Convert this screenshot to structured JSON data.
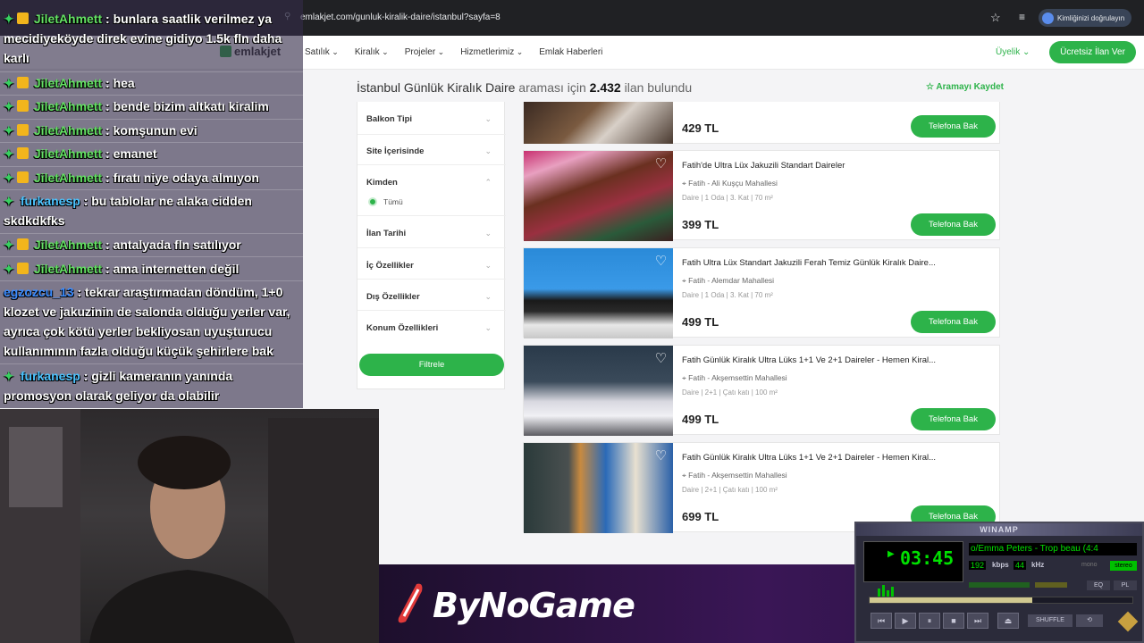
{
  "browser": {
    "url": "emlakjet.com/gunluk-kiralik-daire/istanbul?sayfa=8",
    "profile_label": "Kimliğinizi doğrulayın"
  },
  "site": {
    "logo_text": "emlakjet",
    "nav": [
      "Satılık",
      "Kiralık",
      "Projeler",
      "Hizmetlerimiz",
      "Emlak Haberleri"
    ],
    "uyelik": "Üyelik",
    "cta": "Ücretsiz İlan Ver"
  },
  "results": {
    "query": "İstanbul Günlük Kiralık Daire",
    "middle": " araması için ",
    "count": "2.432",
    "suffix": " ilan bulundu",
    "save": "Aramayı Kaydet"
  },
  "filters": {
    "items": [
      "Balkon Tipi",
      "Site İçerisinde",
      "Kimden",
      "İlan Tarihi",
      "İç Özellikler",
      "Dış Özellikler",
      "Konum Özellikleri"
    ],
    "kimden_option": "Tümü",
    "button": "Filtrele"
  },
  "listings": [
    {
      "title": "",
      "location": "",
      "details": "",
      "price": "429 TL",
      "call": "Telefona Bak"
    },
    {
      "title": "Fatih'de Ultra Lüx Jakuzili Standart Daireler",
      "location": "Fatih - Ali Kuşçu Mahallesi",
      "details": "Daire | 1 Oda | 3. Kat | 70 m²",
      "price": "399 TL",
      "call": "Telefona Bak"
    },
    {
      "title": "Fatih Ultra Lüx Standart Jakuzili Ferah Temiz Günlük Kiralık Daire...",
      "location": "Fatih - Alemdar Mahallesi",
      "details": "Daire | 1 Oda | 3. Kat | 70 m²",
      "price": "499 TL",
      "call": "Telefona Bak"
    },
    {
      "title": "Fatih Günlük Kiralık Ultra Lüks 1+1 Ve 2+1 Daireler - Hemen Kiral...",
      "location": "Fatih - Akşemsettin Mahallesi",
      "details": "Daire | 2+1 | Çatı katı | 100 m²",
      "price": "499 TL",
      "call": "Telefona Bak"
    },
    {
      "title": "Fatih Günlük Kiralık Ultra Lüks 1+1 Ve 2+1 Daireler - Hemen Kiral...",
      "location": "Fatih - Akşemsettin Mahallesi",
      "details": "Daire | 2+1 | Çatı katı | 100 m²",
      "price": "699 TL",
      "call": "Telefona Bak"
    }
  ],
  "chat": [
    {
      "user": "JiletAhmett",
      "text": ": bunlara saatlik verilmez ya mecidiyeköyde direk evine gidiyo 1.5k fln daha karlı",
      "color": "green",
      "badges": true
    },
    {
      "user": "JiletAhmett",
      "text": ": hea",
      "color": "green",
      "badges": true
    },
    {
      "user": "JiletAhmett",
      "text": ": bende bizim altkatı kiralim",
      "color": "green",
      "badges": true
    },
    {
      "user": "JiletAhmett",
      "text": ": komşunun evi",
      "color": "green",
      "badges": true
    },
    {
      "user": "JiletAhmett",
      "text": ": emanet",
      "color": "green",
      "badges": true
    },
    {
      "user": "JiletAhmett",
      "text": ": fıratı niye odaya almıyon",
      "color": "green",
      "badges": true
    },
    {
      "user": "furkanesp",
      "text": ": bu tablolar ne alaka cidden skdkdkfks",
      "color": "cyan",
      "badges": false
    },
    {
      "user": "JiletAhmett",
      "text": ": antalyada fln satılıyor",
      "color": "green",
      "badges": true
    },
    {
      "user": "JiletAhmett",
      "text": ": ama internetten değil",
      "color": "green",
      "badges": true
    },
    {
      "user": "egzozcu_13",
      "text": ": tekrar araştırmadan döndüm, 1+0 klozet ve jakuzinin de salonda olduğu yerler var, ayrıca çok kötü yerler bekliyosan uyuşturucu kullanımının fazla olduğu küçük şehirlere bak",
      "color": "blue",
      "badges": false
    },
    {
      "user": "furkanesp",
      "text": ": gizli kameranın yanında promosyon olarak geliyor da olabilir",
      "color": "cyan",
      "badges": false
    }
  ],
  "banner": {
    "text": "ByNoGame"
  },
  "winamp": {
    "title": "WINAMP",
    "time": "03:45",
    "track": "o/Emma Peters - Trop beau (4:4",
    "kbps": "192",
    "khz": "44",
    "kbps_unit": "kbps",
    "khz_unit": "kHz",
    "mono": "mono",
    "stereo": "stereo",
    "eq": "EQ",
    "pl": "PL",
    "shuffle": "SHUFFLE",
    "progress": 0.62
  },
  "colors": {
    "accent": "#2db34a"
  }
}
